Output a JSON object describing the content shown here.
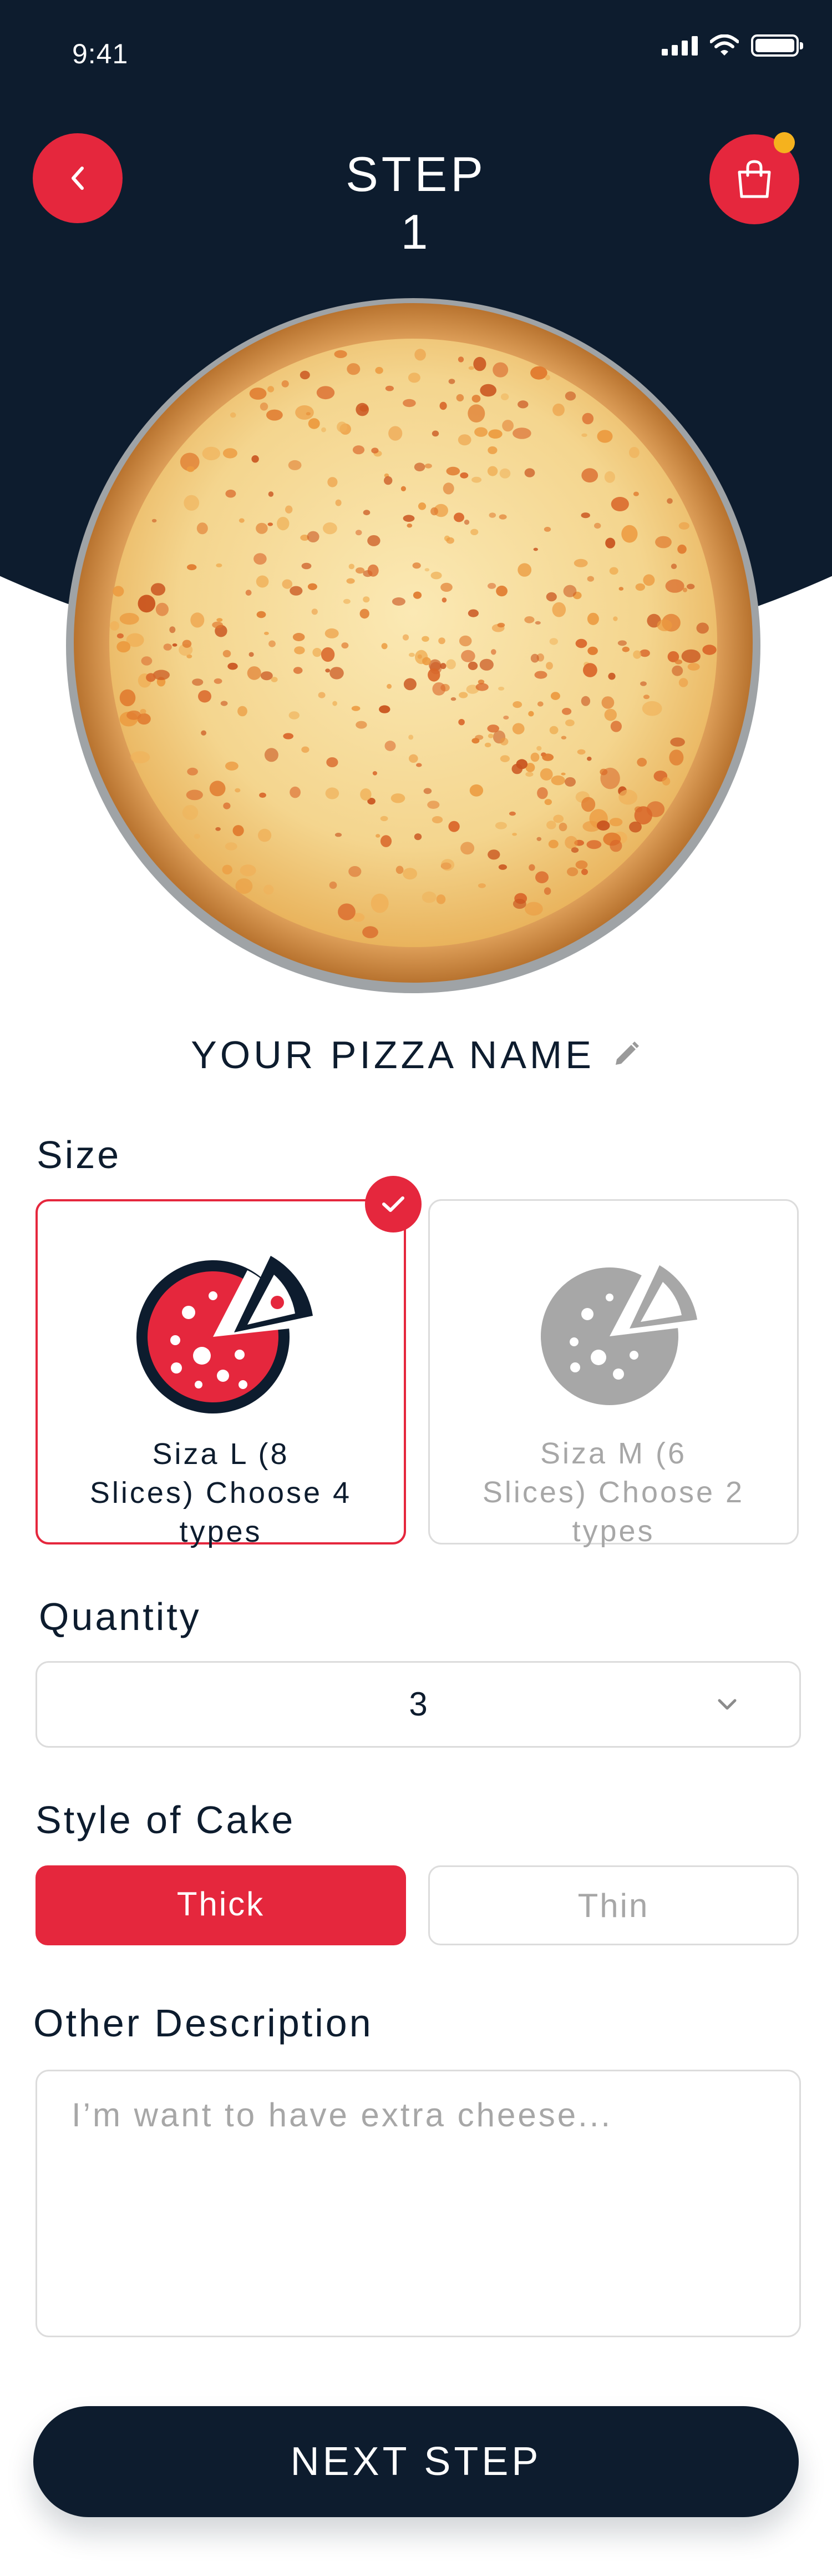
{
  "status_bar": {
    "time": "9:41"
  },
  "header": {
    "title_line1": "STEP",
    "title_line2": "1"
  },
  "icons": {
    "back": "chevron-left-icon",
    "cart": "shopping-bag-icon",
    "edit": "pencil-icon",
    "check": "check-icon",
    "dropdown": "chevron-down-icon",
    "size_option": "pizza-slice-icon"
  },
  "pizza": {
    "name": "YOUR PIZZA NAME"
  },
  "size": {
    "label": "Size",
    "options": [
      {
        "line1": "Siza L (8",
        "line2": "Slices) Choose 4",
        "line3": "types",
        "selected": true
      },
      {
        "line1": "Siza M (6",
        "line2": "Slices) Choose 2",
        "line3": "types",
        "selected": false
      }
    ]
  },
  "quantity": {
    "label": "Quantity",
    "value": "3"
  },
  "style": {
    "label": "Style of Cake",
    "options": [
      "Thick",
      "Thin"
    ],
    "selected": "Thick"
  },
  "description": {
    "label": "Other Description",
    "placeholder": "I’m want to have extra cheese..."
  },
  "next_button": {
    "label": "NEXT STEP"
  },
  "colors": {
    "accent": "#e5273d",
    "navy": "#0d1c2e",
    "badge": "#f5b21e",
    "border": "#dcdcdc",
    "muted": "#a7a7a7"
  }
}
